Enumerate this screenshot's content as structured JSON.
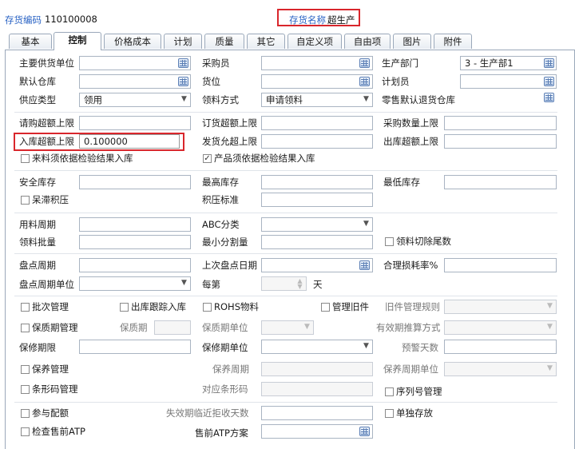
{
  "header": {
    "code_label": "存货编码",
    "code_value": "110100008",
    "name_label": "存货名称",
    "name_value": "超生产"
  },
  "tabs": [
    "基本",
    "控制",
    "价格成本",
    "计划",
    "质量",
    "其它",
    "自定义项",
    "自由项",
    "图片",
    "附件"
  ],
  "form": {
    "main_supplier_unit": "主要供货单位",
    "buyer": "采购员",
    "production_dept": "生产部门",
    "production_dept_value": "3 - 生产部1",
    "default_warehouse": "默认仓库",
    "location": "货位",
    "planner": "计划员",
    "supply_type": "供应类型",
    "supply_type_value": "领用",
    "pick_method": "领料方式",
    "pick_method_value": "申请领料",
    "retail_return_warehouse": "零售默认退货仓库",
    "purchase_request_limit": "请购超额上限",
    "order_limit": "订货超额上限",
    "purchase_qty_limit": "采购数量上限",
    "inbound_limit": "入库超额上限",
    "inbound_limit_value": "0.100000",
    "delivery_limit": "发货允超上限",
    "outbound_limit": "出库超额上限",
    "incoming_by_inspection": "来料须依据检验结果入库",
    "product_by_inspection": "产品须依据检验结果入库",
    "safety_stock": "安全库存",
    "max_stock": "最高库存",
    "min_stock": "最低库存",
    "stagnant": "呆滞积压",
    "overstock_std": "积压标准",
    "material_cycle": "用料周期",
    "abc": "ABC分类",
    "pick_batch": "领料批量",
    "min_split": "最小分割量",
    "pick_trim": "领料切除尾数",
    "count_cycle": "盘点周期",
    "last_count_date": "上次盘点日期",
    "loss_rate": "合理损耗率%",
    "count_cycle_unit": "盘点周期单位",
    "every": "每第",
    "day": "天",
    "batch_mgmt": "批次管理",
    "out_track_in": "出库跟踪入库",
    "rohs": "ROHS物料",
    "old_mgmt": "管理旧件",
    "old_rule": "旧件管理规则",
    "shelf_mgmt": "保质期管理",
    "shelf_period": "保质期",
    "shelf_unit": "保质期单位",
    "expiry_method": "有效期推算方式",
    "warranty": "保修期限",
    "warranty_unit": "保修期单位",
    "warn_days": "预警天数",
    "maintenance": "保养管理",
    "maint_cycle": "保养周期",
    "maint_unit": "保养周期单位",
    "barcode": "条形码管理",
    "barcode_map": "对应条形码",
    "serial": "序列号管理",
    "bom": "参与配额",
    "expiry_reject": "失效期临近拒收天数",
    "single_stock": "单独存放",
    "atp_check": "检查售前ATP",
    "atp_plan": "售前ATP方案"
  }
}
